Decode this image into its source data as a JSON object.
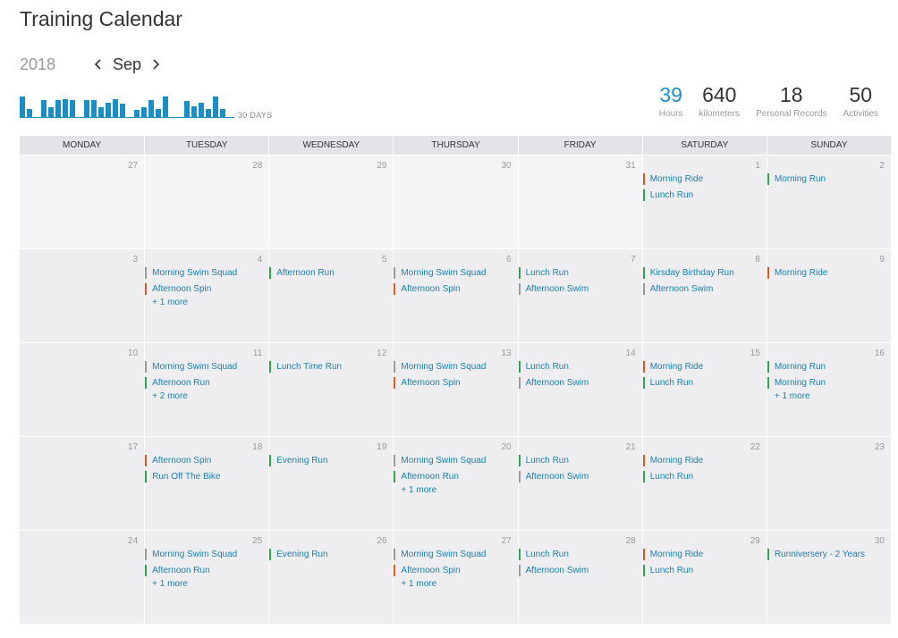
{
  "title": "Training Calendar",
  "nav": {
    "year": "2018",
    "month": "Sep"
  },
  "sparkline": {
    "label": "30 DAYS",
    "color": "#1a8fc7",
    "values": [
      0.85,
      0.35,
      0,
      0.7,
      0.4,
      0.7,
      0.75,
      0.7,
      0,
      0.7,
      0.7,
      0.4,
      0.6,
      0.75,
      0.55,
      0,
      0.3,
      0.4,
      0.7,
      0.35,
      0.85,
      0,
      0,
      0.65,
      0.45,
      0.6,
      0.35,
      0.85,
      0.35,
      0
    ]
  },
  "stats": [
    {
      "value": "39",
      "label": "Hours",
      "accent": true
    },
    {
      "value": "640",
      "label": "kilometers",
      "accent": false
    },
    {
      "value": "18",
      "label": "Personal Records",
      "accent": false
    },
    {
      "value": "50",
      "label": "Activities",
      "accent": false
    }
  ],
  "colors": {
    "accent": "#1a8fc7",
    "run": "#2ea44f",
    "ride": "#e8541e",
    "swim": "#999999",
    "link": "#1a7fb5"
  },
  "weekdays": [
    "MONDAY",
    "TUESDAY",
    "WEDNESDAY",
    "THURSDAY",
    "FRIDAY",
    "SATURDAY",
    "SUNDAY"
  ],
  "weeks": [
    [
      {
        "day": "27",
        "other": true,
        "acts": []
      },
      {
        "day": "28",
        "other": true,
        "acts": []
      },
      {
        "day": "29",
        "other": true,
        "acts": []
      },
      {
        "day": "30",
        "other": true,
        "acts": []
      },
      {
        "day": "31",
        "other": true,
        "acts": []
      },
      {
        "day": "1",
        "acts": [
          {
            "name": "Morning Ride",
            "type": "ride"
          },
          {
            "name": "Lunch Run",
            "type": "run"
          }
        ]
      },
      {
        "day": "2",
        "acts": [
          {
            "name": "Morning Run",
            "type": "run"
          }
        ]
      }
    ],
    [
      {
        "day": "3",
        "acts": []
      },
      {
        "day": "4",
        "acts": [
          {
            "name": "Morning Swim Squad",
            "type": "swim"
          },
          {
            "name": "Afternoon Spin",
            "type": "ride"
          }
        ],
        "more": "+ 1 more"
      },
      {
        "day": "5",
        "acts": [
          {
            "name": "Afternoon Run",
            "type": "run"
          }
        ]
      },
      {
        "day": "6",
        "acts": [
          {
            "name": "Morning Swim Squad",
            "type": "swim"
          },
          {
            "name": "Afternoon Spin",
            "type": "ride"
          }
        ]
      },
      {
        "day": "7",
        "acts": [
          {
            "name": "Lunch Run",
            "type": "run"
          },
          {
            "name": "Afternoon Swim",
            "type": "swim"
          }
        ]
      },
      {
        "day": "8",
        "acts": [
          {
            "name": "Kirsday Birthday Run",
            "type": "run"
          },
          {
            "name": "Afternoon Swim",
            "type": "swim"
          }
        ]
      },
      {
        "day": "9",
        "acts": [
          {
            "name": "Morning Ride",
            "type": "ride"
          }
        ]
      }
    ],
    [
      {
        "day": "10",
        "acts": []
      },
      {
        "day": "11",
        "acts": [
          {
            "name": "Morning Swim Squad",
            "type": "swim"
          },
          {
            "name": "Afternoon Run",
            "type": "run"
          }
        ],
        "more": "+ 2 more"
      },
      {
        "day": "12",
        "acts": [
          {
            "name": "Lunch Time Run",
            "type": "run"
          }
        ]
      },
      {
        "day": "13",
        "acts": [
          {
            "name": "Morning Swim Squad",
            "type": "swim"
          },
          {
            "name": "Afternoon Spin",
            "type": "ride"
          }
        ]
      },
      {
        "day": "14",
        "acts": [
          {
            "name": "Lunch Run",
            "type": "run"
          },
          {
            "name": "Afternoon Swim",
            "type": "swim"
          }
        ]
      },
      {
        "day": "15",
        "acts": [
          {
            "name": "Morning Ride",
            "type": "ride"
          },
          {
            "name": "Lunch Run",
            "type": "run"
          }
        ]
      },
      {
        "day": "16",
        "acts": [
          {
            "name": "Morning Run",
            "type": "run"
          },
          {
            "name": "Morning Run",
            "type": "run"
          }
        ],
        "more": "+ 1 more"
      }
    ],
    [
      {
        "day": "17",
        "acts": []
      },
      {
        "day": "18",
        "acts": [
          {
            "name": "Afternoon Spin",
            "type": "ride"
          },
          {
            "name": "Run Off The Bike",
            "type": "run"
          }
        ]
      },
      {
        "day": "19",
        "acts": [
          {
            "name": "Evening Run",
            "type": "run"
          }
        ]
      },
      {
        "day": "20",
        "acts": [
          {
            "name": "Morning Swim Squad",
            "type": "swim"
          },
          {
            "name": "Afternoon Run",
            "type": "run"
          }
        ],
        "more": "+ 1 more"
      },
      {
        "day": "21",
        "acts": [
          {
            "name": "Lunch Run",
            "type": "run"
          },
          {
            "name": "Afternoon Swim",
            "type": "swim"
          }
        ]
      },
      {
        "day": "22",
        "acts": [
          {
            "name": "Morning Ride",
            "type": "ride"
          },
          {
            "name": "Lunch Run",
            "type": "run"
          }
        ]
      },
      {
        "day": "23",
        "acts": []
      }
    ],
    [
      {
        "day": "24",
        "acts": []
      },
      {
        "day": "25",
        "acts": [
          {
            "name": "Morning Swim Squad",
            "type": "swim"
          },
          {
            "name": "Afternoon Run",
            "type": "run"
          }
        ],
        "more": "+ 1 more"
      },
      {
        "day": "26",
        "acts": [
          {
            "name": "Evening Run",
            "type": "run"
          }
        ]
      },
      {
        "day": "27",
        "acts": [
          {
            "name": "Morning Swim Squad",
            "type": "swim"
          },
          {
            "name": "Afternoon Spin",
            "type": "ride"
          }
        ],
        "more": "+ 1 more"
      },
      {
        "day": "28",
        "acts": [
          {
            "name": "Lunch Run",
            "type": "run"
          },
          {
            "name": "Afternoon Swim",
            "type": "swim"
          }
        ]
      },
      {
        "day": "29",
        "acts": [
          {
            "name": "Morning Ride",
            "type": "ride"
          },
          {
            "name": "Lunch Run",
            "type": "run"
          }
        ]
      },
      {
        "day": "30",
        "acts": [
          {
            "name": "Runniversery - 2 Years",
            "type": "run"
          }
        ]
      }
    ]
  ]
}
